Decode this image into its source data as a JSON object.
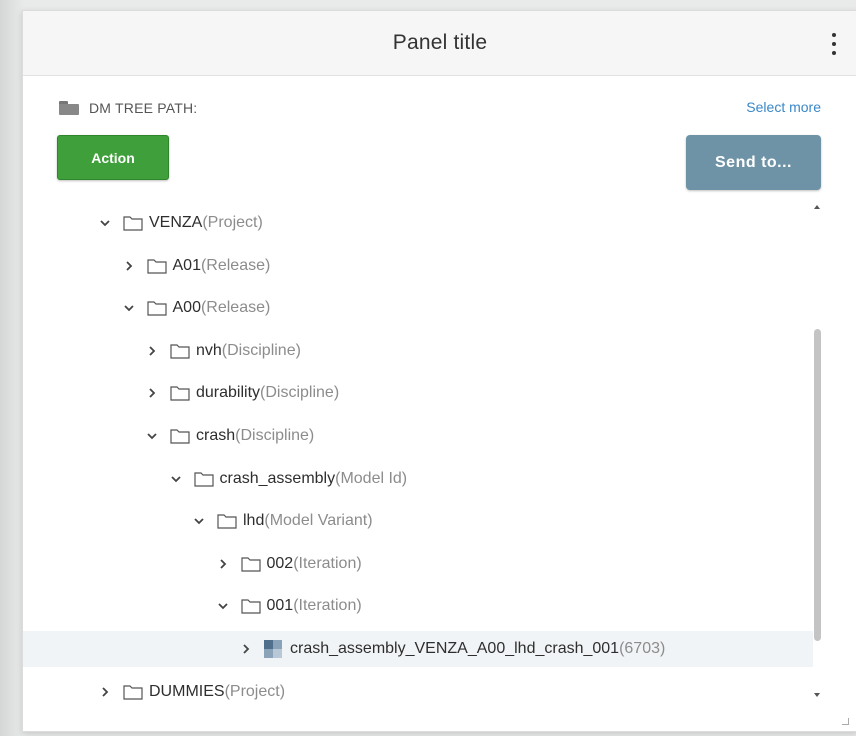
{
  "panel": {
    "title": "Panel title",
    "menu_icon": "kebab-menu-icon"
  },
  "path": {
    "icon": "folder-stack-icon",
    "label": "DM TREE PATH:",
    "select_more": "Select more"
  },
  "buttons": {
    "action": "Action",
    "send_to": "Send to..."
  },
  "colors": {
    "action_bg": "#3f9f3a",
    "send_bg": "#6e93a6",
    "link": "#3a87c8",
    "type_text": "#8c8c8c"
  },
  "tree": [
    {
      "name": "VENZA",
      "type": "(Project)",
      "expanded": true,
      "level": 0,
      "icon": "folder-icon"
    },
    {
      "name": "A01",
      "type": "(Release)",
      "expanded": false,
      "level": 1,
      "icon": "folder-icon"
    },
    {
      "name": "A00",
      "type": "(Release)",
      "expanded": true,
      "level": 1,
      "icon": "folder-icon"
    },
    {
      "name": "nvh",
      "type": "(Discipline)",
      "expanded": false,
      "level": 2,
      "icon": "folder-icon"
    },
    {
      "name": "durability",
      "type": "(Discipline)",
      "expanded": false,
      "level": 2,
      "icon": "folder-icon"
    },
    {
      "name": "crash",
      "type": "(Discipline)",
      "expanded": true,
      "level": 2,
      "icon": "folder-icon"
    },
    {
      "name": "crash_assembly",
      "type": "(Model Id)",
      "expanded": true,
      "level": 3,
      "icon": "folder-icon"
    },
    {
      "name": "lhd",
      "type": "(Model Variant)",
      "expanded": true,
      "level": 4,
      "icon": "folder-icon"
    },
    {
      "name": "002",
      "type": "(Iteration)",
      "expanded": false,
      "level": 5,
      "icon": "folder-icon"
    },
    {
      "name": "001",
      "type": "(Iteration)",
      "expanded": true,
      "level": 5,
      "icon": "folder-icon"
    },
    {
      "name": "crash_assembly_VENZA_A00_lhd_crash_001",
      "type": "(6703)",
      "expanded": false,
      "level": 6,
      "icon": "model-icon",
      "selected": true
    },
    {
      "name": "DUMMIES",
      "type": "(Project)",
      "expanded": false,
      "level": 0,
      "icon": "folder-icon"
    }
  ]
}
